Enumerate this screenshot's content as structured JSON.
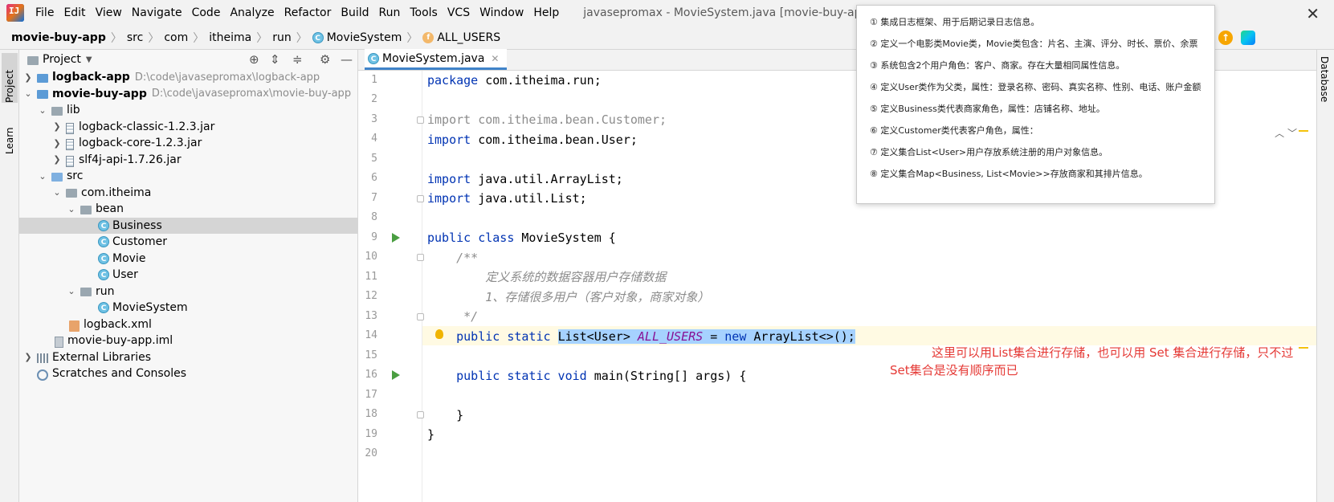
{
  "menubar": {
    "logo_text": "IJ",
    "items": [
      "File",
      "Edit",
      "View",
      "Navigate",
      "Code",
      "Analyze",
      "Refactor",
      "Build",
      "Run",
      "Tools",
      "VCS",
      "Window",
      "Help"
    ],
    "title": "javasepromax - MovieSystem.java [movie-buy-app]",
    "close_glyph": "✕"
  },
  "breadcrumb": {
    "items": [
      "movie-buy-app",
      "src",
      "com",
      "itheima",
      "run",
      "MovieSystem",
      "ALL_USERS"
    ]
  },
  "strips": {
    "left": [
      "Project",
      "Learn"
    ],
    "right": [
      "Database"
    ]
  },
  "project_panel": {
    "title": "Project",
    "tree": [
      {
        "label": "logback-app",
        "hint": "D:\\code\\javasepromax\\logback-app"
      },
      {
        "label": "movie-buy-app",
        "hint": "D:\\code\\javasepromax\\movie-buy-app"
      },
      {
        "label": "lib"
      },
      {
        "label": "logback-classic-1.2.3.jar"
      },
      {
        "label": "logback-core-1.2.3.jar"
      },
      {
        "label": "slf4j-api-1.7.26.jar"
      },
      {
        "label": "src"
      },
      {
        "label": "com.itheima"
      },
      {
        "label": "bean"
      },
      {
        "label": "Business"
      },
      {
        "label": "Customer"
      },
      {
        "label": "Movie"
      },
      {
        "label": "User"
      },
      {
        "label": "run"
      },
      {
        "label": "MovieSystem"
      },
      {
        "label": "logback.xml"
      },
      {
        "label": "movie-buy-app.iml"
      },
      {
        "label": "External Libraries"
      },
      {
        "label": "Scratches and Consoles"
      }
    ]
  },
  "editor": {
    "tab_label": "MovieSystem.java",
    "line_numbers": [
      "1",
      "2",
      "3",
      "4",
      "5",
      "6",
      "7",
      "8",
      "9",
      "10",
      "11",
      "12",
      "13",
      "14",
      "15",
      "16",
      "17",
      "18",
      "19",
      "20"
    ],
    "code": {
      "l1_kw": "package",
      "l1_rest": " com.itheima.run;",
      "l3": "import com.itheima.bean.Customer;",
      "l4_kw": "import",
      "l4_rest": " com.itheima.bean.User;",
      "l6_kw": "import",
      "l6_rest": " java.util.ArrayList;",
      "l7_kw": "import",
      "l7_rest": " java.util.List;",
      "l9_kw": "public class",
      "l9_rest": " MovieSystem {",
      "l10": "    /**",
      "l11": "        定义系统的数据容器用户存储数据",
      "l12": "        1、存储很多用户（客户对象，商家对象）",
      "l13": "     */",
      "l14_indent": "    ",
      "l14_kw": "public static",
      "l14_sp": " ",
      "l14_type": "List<User> ",
      "l14_field": "ALL_USERS",
      "l14_eq": " = ",
      "l14_new": "new",
      "l14_rest": " ArrayList<>();",
      "l16_indent": "    ",
      "l16_kw": "public static void",
      "l16_rest": " main(String[] args) {",
      "l18": "    }",
      "l19": "}"
    },
    "annotation_line1": "这里可以用List集合进行存储，也可以用    Set 集合进行存储，只不过",
    "annotation_line2": "Set集合是没有顺序而已"
  },
  "requirements_popup": {
    "items": [
      "① 集成日志框架、用于后期记录日志信息。",
      "② 定义一个电影类Movie类，Movie类包含：片名、主演、评分、时长、票价、余票",
      "③ 系统包含2个用户角色：客户、商家。存在大量相同属性信息。",
      "④ 定义User类作为父类，属性：登录名称、密码、真实名称、性别、电话、账户金额",
      "⑤ 定义Business类代表商家角色，属性：店铺名称、地址。",
      "⑥ 定义Customer类代表客户角色，属性：",
      "⑦ 定义集合List<User>用户存放系统注册的用户对象信息。",
      "⑧ 定义集合Map<Business, List<Movie>>存放商家和其排片信息。"
    ]
  },
  "colors": {
    "keyword": "#0033b3",
    "comment": "#8c8c8c",
    "static_field": "#871094",
    "selection": "#a6d2ff",
    "annotation": "#e53935"
  }
}
